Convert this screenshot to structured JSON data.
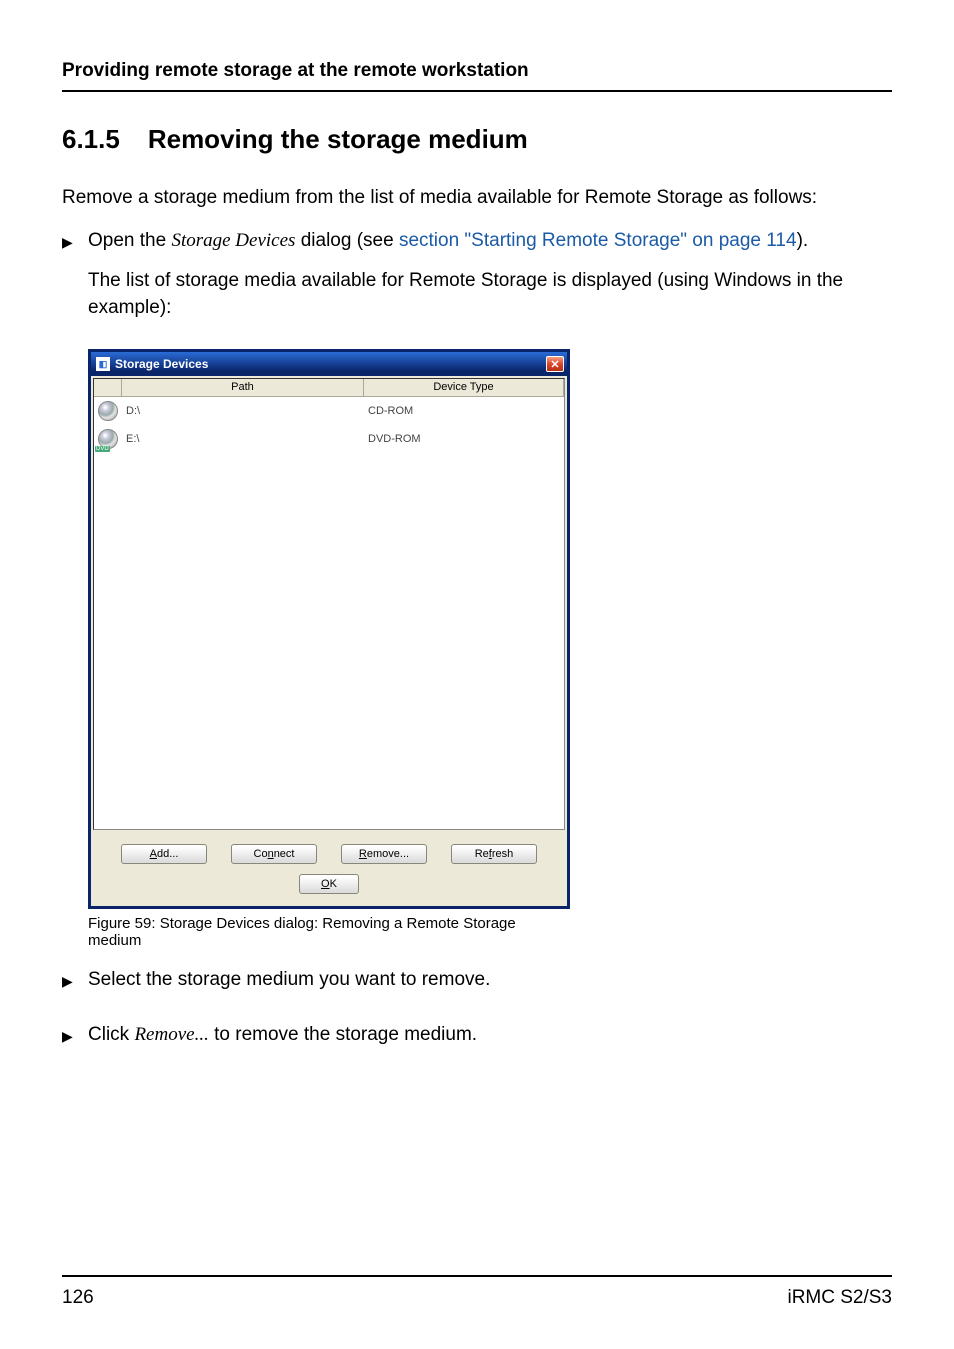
{
  "header": {
    "running": "Providing remote storage at the remote workstation"
  },
  "section": {
    "number": "6.1.5",
    "title": "Removing the storage medium"
  },
  "intro": "Remove a storage medium from the list of media available for Remote Storage as follows:",
  "steps": {
    "open_pre": "Open the ",
    "open_dlg": "Storage Devices",
    "open_mid": " dialog (see ",
    "open_xref": "section \"Starting Remote Storage\" on page 114",
    "open_post": ").",
    "displayed": "The list of storage media available for Remote Storage is displayed (using Windows in the example):",
    "select": "Select the storage medium you want to remove.",
    "click_pre": "Click ",
    "click_cmd": "Remove...",
    "click_post": " to remove the storage medium."
  },
  "dialog": {
    "title": "Storage Devices",
    "cols": {
      "path": "Path",
      "type": "Device Type"
    },
    "rows": [
      {
        "path": "D:\\",
        "type": "CD-ROM",
        "dvd": false
      },
      {
        "path": "E:\\",
        "type": "DVD-ROM",
        "dvd": true
      }
    ],
    "buttons": {
      "add": "Add...",
      "connect": "Connect",
      "remove": "Remove...",
      "refresh": "Refresh",
      "ok": "OK"
    },
    "mnemonics": {
      "add": "A",
      "connect": "n",
      "remove": "R",
      "refresh": "f",
      "ok": "O"
    }
  },
  "figure_caption": "Figure 59:  Storage Devices dialog: Removing a Remote Storage medium",
  "footer": {
    "page": "126",
    "doc": "iRMC S2/S3"
  },
  "dvd_badge": "DVD"
}
